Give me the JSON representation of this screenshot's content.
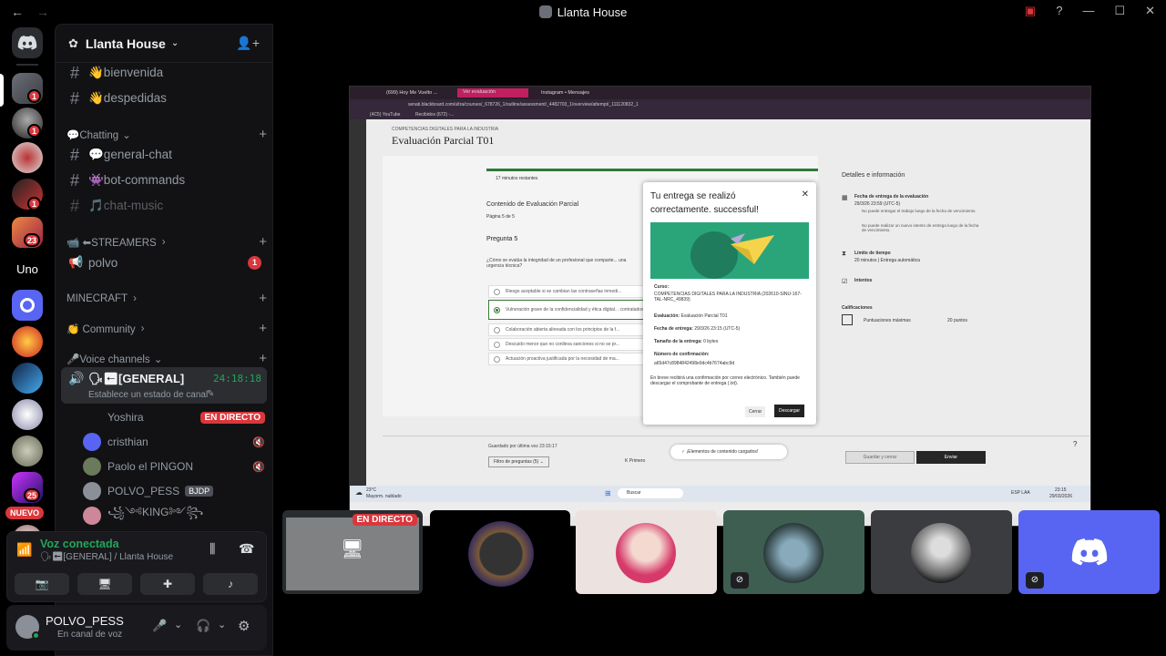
{
  "window": {
    "title": "Llanta House"
  },
  "rail": {
    "uno_label": "Uno",
    "new_label": "NUEVO",
    "badges": [
      "1",
      "1",
      "1",
      "1",
      "23",
      "25"
    ]
  },
  "guild": {
    "name": "Llanta House"
  },
  "channels": {
    "top": [
      {
        "name": "👋bienvenida"
      },
      {
        "name": "👋despedidas"
      }
    ],
    "chatting_cat": "💬Chatting",
    "chatting": [
      {
        "name": "💬general-chat"
      },
      {
        "name": "👾bot-commands"
      },
      {
        "name": "🎵chat-music"
      }
    ],
    "streamers_cat": "📹 ⬅STREAMERS",
    "polvo": {
      "name": "polvo",
      "badge": "1"
    },
    "minecraft_cat": "MINECRAFT",
    "community_cat": "👏 Community",
    "voice_cat": "🎤Voice channels",
    "general_voice": {
      "name": "🗣⬅[GENERAL]",
      "timer": "24:18:18",
      "status": "Establece un estado de canal"
    },
    "members": [
      {
        "name": "Yoshira",
        "live": "EN DIRECTO"
      },
      {
        "name": "cristhian"
      },
      {
        "name": "Paolo el PINGON"
      },
      {
        "name": "POLVO_PESS",
        "tag": "BJDP"
      },
      {
        "name": "꧁༺KING༻꧂"
      }
    ]
  },
  "voice_panel": {
    "status": "Voz conectada",
    "channel": "🗣⬅[GENERAL] / Llanta House"
  },
  "user_panel": {
    "name": "POLVO_PESS",
    "status": "En canal de voz"
  },
  "stream": {
    "live_label": "EN DIRECTO",
    "tabs": [
      "(699) Hoy Me Vuelto ...",
      "Ver evaluación",
      "Instagram • Mensajes"
    ],
    "url": "senati.blackboard.com/ultra/courses/_678726_1/outline/assessment/_4482703_1/overview/attempt/_111120832_1",
    "bookmarks": [
      "(4C5) YouTube",
      "Recibidos (672) -..."
    ],
    "course_small": "COMPETENCIAS DIGITALES PARA LA INDUSTRIA",
    "exam_title": "Evaluación Parcial T01",
    "time_left": "17 minutos restantes",
    "content_label": "Contenido de Evaluación Parcial",
    "page_label": "Página 5 de 5",
    "question_label": "Pregunta 5",
    "question_text": "¿Cómo se evalúa la integridad de un profesional que comparte... una urgencia técnica?",
    "options": [
      "Riesgo aceptable si se cambian las contraseñas inmedi...",
      "Vulneración grave de la confidencialidad y ética digital... contratados.",
      "Colaboración abierta alineada con los principios de la f...",
      "Descuido menor que no conlleva sanciones si no se pr...",
      "Actuación proactiva justificada por la necesidad de ma..."
    ],
    "saved_label": "Guardado por última vez 23:15:17",
    "filter_label": "Filtro de preguntas (5)",
    "first_label": "Primero",
    "loaded_toast": "¡Elementos de contenido cargados!",
    "save_close": "Guardar y cerrar",
    "send": "Enviar",
    "details_title": "Detalles e información",
    "due_title": "Fecha de entrega de la evaluación",
    "due_value": "29/3/26 23:59 (UTC-5)",
    "due_note1": "No puede entregar el trabajo luego de la fecha de vencimiento.",
    "due_note2": "No puede realizar un nuevo intento de entrega luego de la fecha de vencimiento.",
    "limit_title": "Límite de tiempo",
    "limit_value": "20 minutos | Entrega automática",
    "attempts_title": "Intentos",
    "grades_title": "Calificaciones",
    "max_score_label": "Puntuaciones máximas",
    "max_score_value": "20 puntos",
    "modal": {
      "title": "Tu entrega se realizó correctamente. successful!",
      "course_label": "Curso:",
      "course_value": "COMPETENCIAS DIGITALES PARA LA INDUSTRIA (202610-SINU-167-TAL-NRC_49839)",
      "eval_label": "Evaluación:",
      "eval_value": "Evaluación Parcial T01",
      "date_label": "Fecha de entrega:",
      "date_value": "29/3/26 23:15 (UTC-5)",
      "size_label": "Tamaño de la entrega:",
      "size_value": "0 bytes",
      "conf_label": "Número de confirmación:",
      "conf_value": "a65d47c8984842498e0dc4b7674abc9d",
      "note": "En breve recibirá una confirmación por correo electrónico. También puede descargar el comprobante de entrega (.txt).",
      "close_btn": "Cerrar",
      "download_btn": "Descargar"
    },
    "taskbar": {
      "weather_temp": "23°C",
      "weather_text": "Mayorm. nublado",
      "search": "Buscar",
      "lang": "ESP LAA",
      "time": "23:15",
      "date": "29/03/2026"
    }
  },
  "colors": {
    "accent": "#5865f2",
    "live_red": "#da373c",
    "voice_green": "#23a55a"
  }
}
